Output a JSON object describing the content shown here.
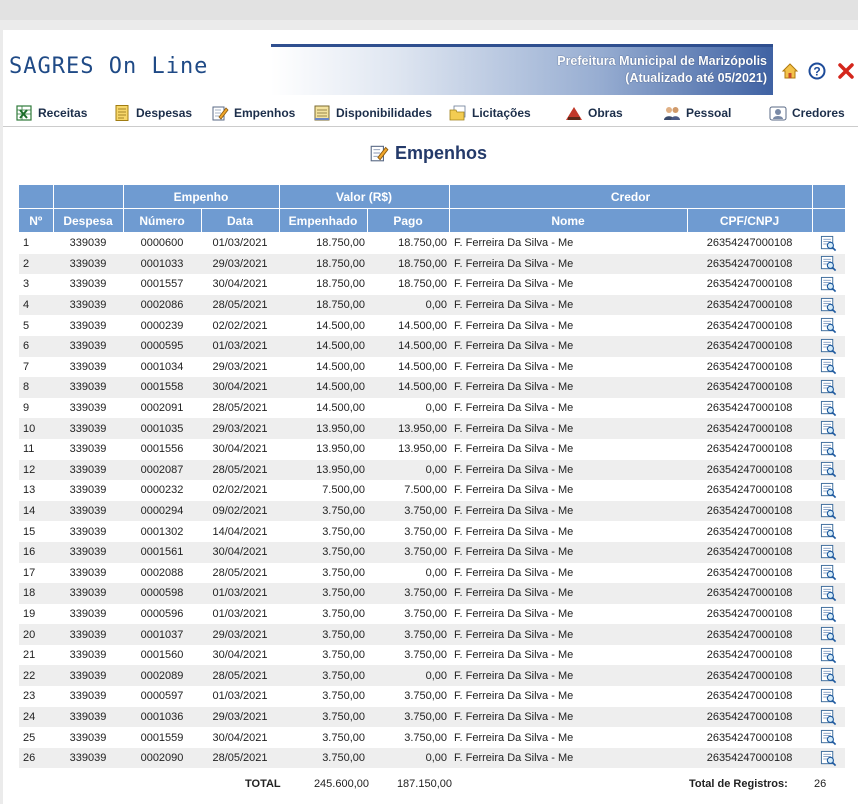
{
  "header": {
    "logo": "SAGRES On Line",
    "org_name": "Prefeitura Municipal de Marizópolis",
    "updated": "(Atualizado até 05/2021)"
  },
  "icons": {
    "home": "home-icon",
    "help": "help-icon",
    "close": "close-icon",
    "row": "detail-view-icon"
  },
  "nav": {
    "receitas": "Receitas",
    "despesas": "Despesas",
    "empenhos": "Empenhos",
    "disponibilidades": "Disponibilidades",
    "licitacoes": "Licitações",
    "obras": "Obras",
    "pessoal": "Pessoal",
    "credores": "Credores"
  },
  "page": {
    "title": "Empenhos"
  },
  "table": {
    "group_headers": {
      "empenho": "Empenho",
      "valor": "Valor (R$)",
      "credor": "Credor"
    },
    "columns": {
      "n": "Nº",
      "despesa": "Despesa",
      "numero": "Número",
      "data": "Data",
      "empenhado": "Empenhado",
      "pago": "Pago",
      "nome": "Nome",
      "cpf": "CPF/CNPJ"
    },
    "rows": [
      [
        "1",
        "339039",
        "0000600",
        "01/03/2021",
        "18.750,00",
        "18.750,00",
        "F. Ferreira Da Silva - Me",
        "26354247000108"
      ],
      [
        "2",
        "339039",
        "0001033",
        "29/03/2021",
        "18.750,00",
        "18.750,00",
        "F. Ferreira Da Silva - Me",
        "26354247000108"
      ],
      [
        "3",
        "339039",
        "0001557",
        "30/04/2021",
        "18.750,00",
        "18.750,00",
        "F. Ferreira Da Silva - Me",
        "26354247000108"
      ],
      [
        "4",
        "339039",
        "0002086",
        "28/05/2021",
        "18.750,00",
        "0,00",
        "F. Ferreira Da Silva - Me",
        "26354247000108"
      ],
      [
        "5",
        "339039",
        "0000239",
        "02/02/2021",
        "14.500,00",
        "14.500,00",
        "F. Ferreira Da Silva - Me",
        "26354247000108"
      ],
      [
        "6",
        "339039",
        "0000595",
        "01/03/2021",
        "14.500,00",
        "14.500,00",
        "F. Ferreira Da Silva - Me",
        "26354247000108"
      ],
      [
        "7",
        "339039",
        "0001034",
        "29/03/2021",
        "14.500,00",
        "14.500,00",
        "F. Ferreira Da Silva - Me",
        "26354247000108"
      ],
      [
        "8",
        "339039",
        "0001558",
        "30/04/2021",
        "14.500,00",
        "14.500,00",
        "F. Ferreira Da Silva - Me",
        "26354247000108"
      ],
      [
        "9",
        "339039",
        "0002091",
        "28/05/2021",
        "14.500,00",
        "0,00",
        "F. Ferreira Da Silva - Me",
        "26354247000108"
      ],
      [
        "10",
        "339039",
        "0001035",
        "29/03/2021",
        "13.950,00",
        "13.950,00",
        "F. Ferreira Da Silva - Me",
        "26354247000108"
      ],
      [
        "11",
        "339039",
        "0001556",
        "30/04/2021",
        "13.950,00",
        "13.950,00",
        "F. Ferreira Da Silva - Me",
        "26354247000108"
      ],
      [
        "12",
        "339039",
        "0002087",
        "28/05/2021",
        "13.950,00",
        "0,00",
        "F. Ferreira Da Silva - Me",
        "26354247000108"
      ],
      [
        "13",
        "339039",
        "0000232",
        "02/02/2021",
        "7.500,00",
        "7.500,00",
        "F. Ferreira Da Silva - Me",
        "26354247000108"
      ],
      [
        "14",
        "339039",
        "0000294",
        "09/02/2021",
        "3.750,00",
        "3.750,00",
        "F. Ferreira Da Silva - Me",
        "26354247000108"
      ],
      [
        "15",
        "339039",
        "0001302",
        "14/04/2021",
        "3.750,00",
        "3.750,00",
        "F. Ferreira Da Silva - Me",
        "26354247000108"
      ],
      [
        "16",
        "339039",
        "0001561",
        "30/04/2021",
        "3.750,00",
        "3.750,00",
        "F. Ferreira Da Silva - Me",
        "26354247000108"
      ],
      [
        "17",
        "339039",
        "0002088",
        "28/05/2021",
        "3.750,00",
        "0,00",
        "F. Ferreira Da Silva - Me",
        "26354247000108"
      ],
      [
        "18",
        "339039",
        "0000598",
        "01/03/2021",
        "3.750,00",
        "3.750,00",
        "F. Ferreira Da Silva - Me",
        "26354247000108"
      ],
      [
        "19",
        "339039",
        "0000596",
        "01/03/2021",
        "3.750,00",
        "3.750,00",
        "F. Ferreira Da Silva - Me",
        "26354247000108"
      ],
      [
        "20",
        "339039",
        "0001037",
        "29/03/2021",
        "3.750,00",
        "3.750,00",
        "F. Ferreira Da Silva - Me",
        "26354247000108"
      ],
      [
        "21",
        "339039",
        "0001560",
        "30/04/2021",
        "3.750,00",
        "3.750,00",
        "F. Ferreira Da Silva - Me",
        "26354247000108"
      ],
      [
        "22",
        "339039",
        "0002089",
        "28/05/2021",
        "3.750,00",
        "0,00",
        "F. Ferreira Da Silva - Me",
        "26354247000108"
      ],
      [
        "23",
        "339039",
        "0000597",
        "01/03/2021",
        "3.750,00",
        "3.750,00",
        "F. Ferreira Da Silva - Me",
        "26354247000108"
      ],
      [
        "24",
        "339039",
        "0001036",
        "29/03/2021",
        "3.750,00",
        "3.750,00",
        "F. Ferreira Da Silva - Me",
        "26354247000108"
      ],
      [
        "25",
        "339039",
        "0001559",
        "30/04/2021",
        "3.750,00",
        "3.750,00",
        "F. Ferreira Da Silva - Me",
        "26354247000108"
      ],
      [
        "26",
        "339039",
        "0002090",
        "28/05/2021",
        "3.750,00",
        "0,00",
        "F. Ferreira Da Silva - Me",
        "26354247000108"
      ]
    ]
  },
  "totals": {
    "label": "TOTAL",
    "empenhado": "245.600,00",
    "pago": "187.150,00",
    "registros_label": "Total de Registros:",
    "registros": "26"
  }
}
